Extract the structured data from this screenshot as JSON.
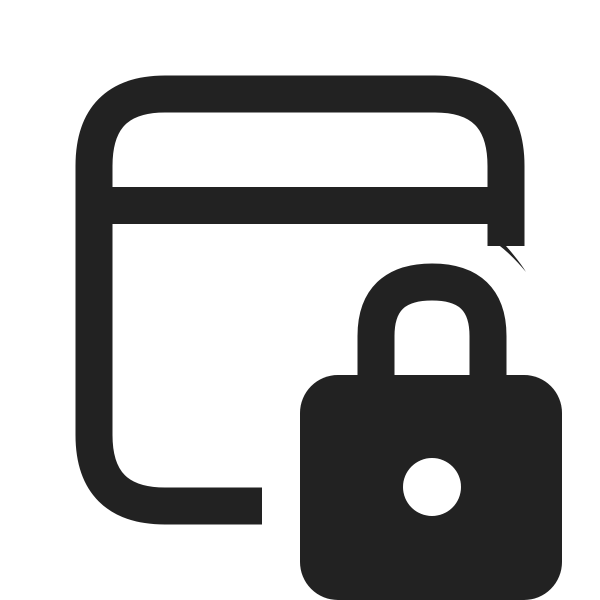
{
  "icon": {
    "name": "calendar-lock-icon",
    "color": "#222222",
    "background": "#ffffff",
    "parts": [
      "window-frame-icon",
      "lock-icon"
    ]
  }
}
